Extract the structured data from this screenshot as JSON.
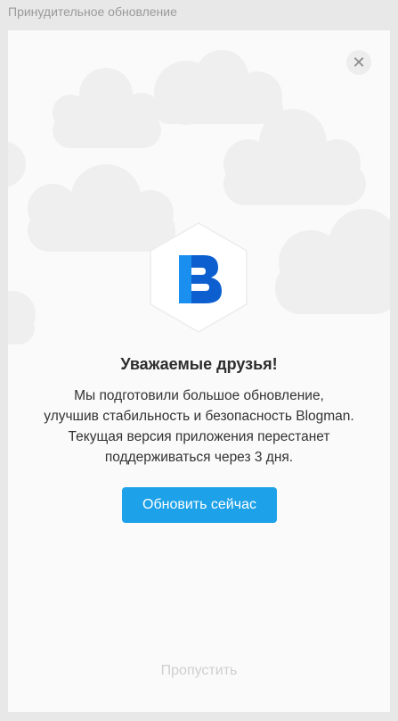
{
  "window": {
    "title": "Принудительное обновление"
  },
  "dialog": {
    "close_symbol": "✕",
    "logo_icon": "blogman-b-logo",
    "heading": "Уважаемые друзья!",
    "message_lines": [
      "Мы подготовили большое обновление,",
      "улучшив стабильность и безопасность Blogman.",
      "Текущая версия приложения перестанет",
      "поддерживаться через 3 дня."
    ],
    "update_button": "Обновить сейчас",
    "skip_link": "Пропустить"
  },
  "colors": {
    "accent": "#1da1e8",
    "logo_blue": "#0d6ad8",
    "background": "#fafafa",
    "cloud": "#f0f0f0"
  }
}
